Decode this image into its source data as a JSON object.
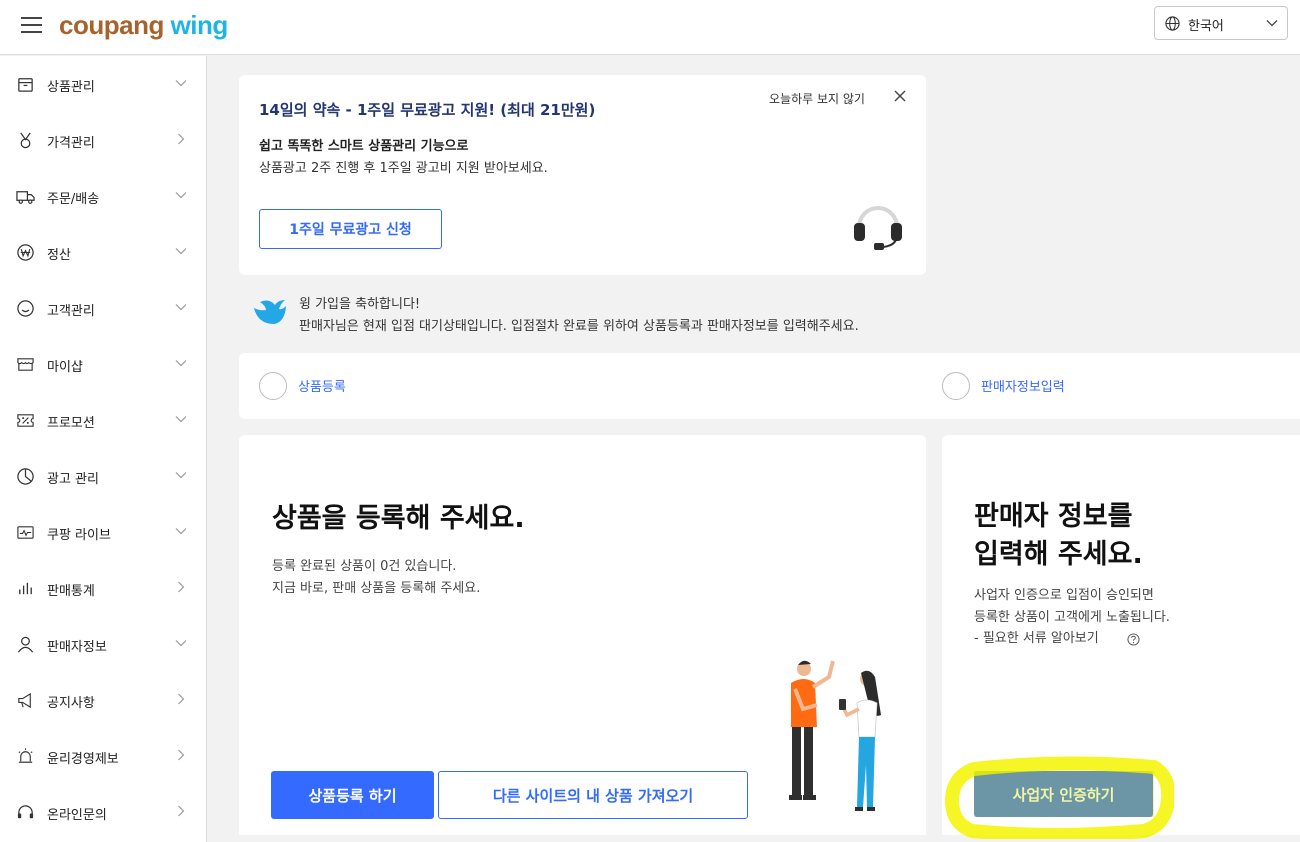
{
  "header": {
    "logo_part1": "coupang",
    "logo_part2": "wing",
    "language": "한국어"
  },
  "sidebar": {
    "items": [
      {
        "label": "상품관리",
        "arrow": "down"
      },
      {
        "label": "가격관리",
        "arrow": "right"
      },
      {
        "label": "주문/배송",
        "arrow": "down"
      },
      {
        "label": "정산",
        "arrow": "down"
      },
      {
        "label": "고객관리",
        "arrow": "down"
      },
      {
        "label": "마이샵",
        "arrow": "down"
      },
      {
        "label": "프로모션",
        "arrow": "down"
      },
      {
        "label": "광고 관리",
        "arrow": "down"
      },
      {
        "label": "쿠팡 라이브",
        "arrow": "down"
      },
      {
        "label": "판매통계",
        "arrow": "right"
      },
      {
        "label": "판매자정보",
        "arrow": "down"
      },
      {
        "label": "공지사항",
        "arrow": "right"
      },
      {
        "label": "윤리경영제보",
        "arrow": "right"
      },
      {
        "label": "온라인문의",
        "arrow": "right"
      }
    ]
  },
  "banner": {
    "title": "14일의 약속 - 1주일 무료광고 지원! (최대 21만원)",
    "dismiss": "오늘하루 보지 않기",
    "subtitle": "쉽고 똑똑한 스마트 상품관리 기능으로",
    "description": "상품광고 2주 진행 후 1주일 광고비 지원 받아보세요.",
    "button": "1주일 무료광고 신청"
  },
  "welcome": {
    "line1": "윙 가입을 축하합니다!",
    "line2": "판매자님은 현재 입점 대기상태입니다. 입점절차 완료를 위하여 상품등록과 판매자정보를 입력해주세요."
  },
  "steps": {
    "step1": "상품등록",
    "step2": "판매자정보입력"
  },
  "product_card": {
    "title": "상품을 등록해 주세요.",
    "desc1": "등록 완료된 상품이 0건 있습니다.",
    "desc2": "지금 바로, 판매 상품을 등록해 주세요.",
    "primary_button": "상품등록 하기",
    "import_button": "다른 사이트의 내 상품 가져오기"
  },
  "seller_card": {
    "title_line1": "판매자 정보를",
    "title_line2": "입력해 주세요.",
    "desc1": "사업자 인증으로 입점이 승인되면",
    "desc2": "등록한 상품이 고객에게 노출됩니다.",
    "docs_link": "- 필요한 서류 알아보기",
    "verify_button": "사업자 인증하기"
  },
  "colors": {
    "primary": "#346aff",
    "banner_title": "#24366f",
    "highlight": "#f5f500"
  }
}
